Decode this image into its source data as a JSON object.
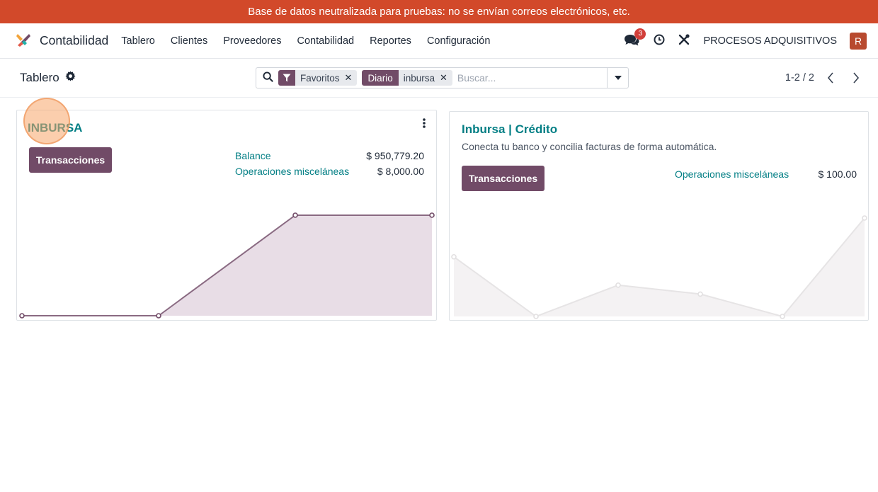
{
  "banner": {
    "text": "Base de datos neutralizada para pruebas: no se envían correos electrónicos, etc."
  },
  "navbar": {
    "app_name": "Contabilidad",
    "menu": [
      "Tablero",
      "Clientes",
      "Proveedores",
      "Contabilidad",
      "Reportes",
      "Configuración"
    ],
    "chat_count": "3",
    "company": "PROCESOS ADQUISITIVOS",
    "avatar_initial": "R"
  },
  "control": {
    "breadcrumb": "Tablero",
    "facets": [
      {
        "tag": "",
        "values": "Favoritos"
      },
      {
        "tag": "Diario",
        "values": "inbursa"
      }
    ],
    "search_placeholder": "Buscar...",
    "pager": "1-2 / 2"
  },
  "cards": [
    {
      "title": "INBURSA",
      "button": "Transacciones",
      "stats": [
        {
          "label": "Balance",
          "value": "$ 950,779.20"
        },
        {
          "label": "Operaciones misceláneas",
          "value": "$ 8,000.00"
        }
      ],
      "accent_color": "#714b67"
    },
    {
      "title": "Inbursa | Crédito",
      "subtitle": "Conecta tu banco y concilia facturas de forma automática.",
      "button": "Transacciones",
      "stats": [
        {
          "label": "Operaciones misceláneas",
          "value": "$ 100.00"
        }
      ],
      "accent_color": "#e3e3e3"
    }
  ],
  "chart_data": [
    {
      "type": "area",
      "series": [
        {
          "values": [
            0,
            0,
            1,
            1
          ]
        }
      ],
      "grid": false,
      "legend": "none"
    },
    {
      "type": "area",
      "series": [
        {
          "values": [
            2,
            0,
            1.05,
            0.75,
            0,
            3.3
          ]
        }
      ],
      "grid": false,
      "legend": "none"
    }
  ],
  "colors": {
    "banner": "#d2492a",
    "brand": "#714b67",
    "link": "#017e84"
  },
  "icons": {
    "app": "accounting-logo-icon",
    "chat": "chat-icon",
    "activity": "clock-icon",
    "tools": "tools-icon",
    "settings": "gear-icon",
    "search": "search-icon",
    "filter": "filter-icon",
    "dropdown": "caret-down-icon"
  }
}
